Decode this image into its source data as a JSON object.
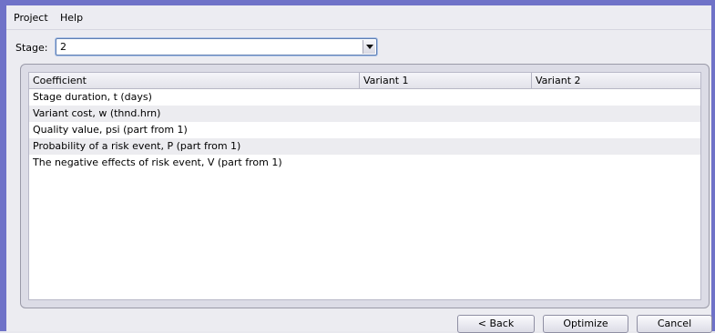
{
  "menubar": {
    "items": [
      "Project",
      "Help"
    ]
  },
  "stage": {
    "label": "Stage:",
    "value": "2"
  },
  "table": {
    "columns": [
      "Coefficient",
      "Variant 1",
      "Variant 2"
    ],
    "rows": [
      [
        "Stage duration, t (days)",
        "",
        ""
      ],
      [
        "Variant cost, w (thnd.hrn)",
        "",
        ""
      ],
      [
        "Quality value, psi (part from 1)",
        "",
        ""
      ],
      [
        "Probability of a risk event, P (part from 1)",
        "",
        ""
      ],
      [
        "The negative effects of risk event, V (part from 1)",
        "",
        ""
      ]
    ]
  },
  "buttons": {
    "back": "< Back",
    "optimize": "Optimize",
    "cancel": "Cancel"
  },
  "colors": {
    "window_border": "#6f72c8",
    "select_focus": "#5f7fb3"
  }
}
